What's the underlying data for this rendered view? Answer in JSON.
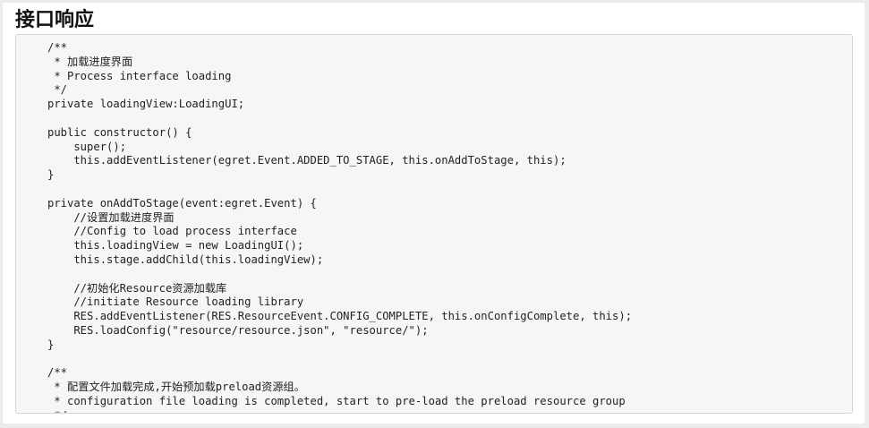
{
  "section": {
    "title": "接口响应"
  },
  "code_block": {
    "lines": [
      "/**",
      " * 加载进度界面",
      " * Process interface loading",
      " */",
      "private loadingView:LoadingUI;",
      "",
      "public constructor() {",
      "    super();",
      "    this.addEventListener(egret.Event.ADDED_TO_STAGE, this.onAddToStage, this);",
      "}",
      "",
      "private onAddToStage(event:egret.Event) {",
      "    //设置加载进度界面",
      "    //Config to load process interface",
      "    this.loadingView = new LoadingUI();",
      "    this.stage.addChild(this.loadingView);",
      "",
      "    //初始化Resource资源加载库",
      "    //initiate Resource loading library",
      "    RES.addEventListener(RES.ResourceEvent.CONFIG_COMPLETE, this.onConfigComplete, this);",
      "    RES.loadConfig(\"resource/resource.json\", \"resource/\");",
      "}",
      "",
      "/**",
      " * 配置文件加载完成,开始预加载preload资源组。",
      " * configuration file loading is completed, start to pre-load the preload resource group",
      " */"
    ]
  }
}
